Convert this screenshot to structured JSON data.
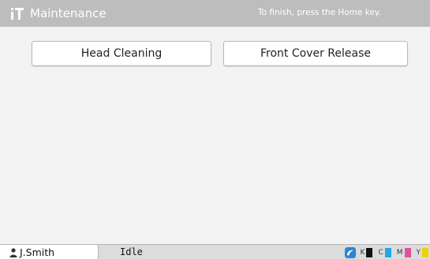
{
  "header": {
    "title": "Maintenance",
    "hint": "To finish, press the Home key.",
    "icon": "maintenance-icon"
  },
  "actions": {
    "head_cleaning": "Head Cleaning",
    "front_cover_release": "Front Cover Release"
  },
  "status_bar": {
    "user": "J.Smith",
    "user_icon": "user-icon",
    "status": "Idle",
    "app_icon": "app-icon",
    "inks": [
      {
        "label": "K",
        "color": "#111111"
      },
      {
        "label": "C",
        "color": "#22a7e6"
      },
      {
        "label": "M",
        "color": "#e2509d"
      },
      {
        "label": "Y",
        "color": "#f0d000"
      }
    ]
  },
  "colors": {
    "titlebar": "#bdbdbd",
    "content_bg": "#f3f3f3",
    "statusbar": "#dcdcdc",
    "app_icon": "#2a86d6"
  }
}
